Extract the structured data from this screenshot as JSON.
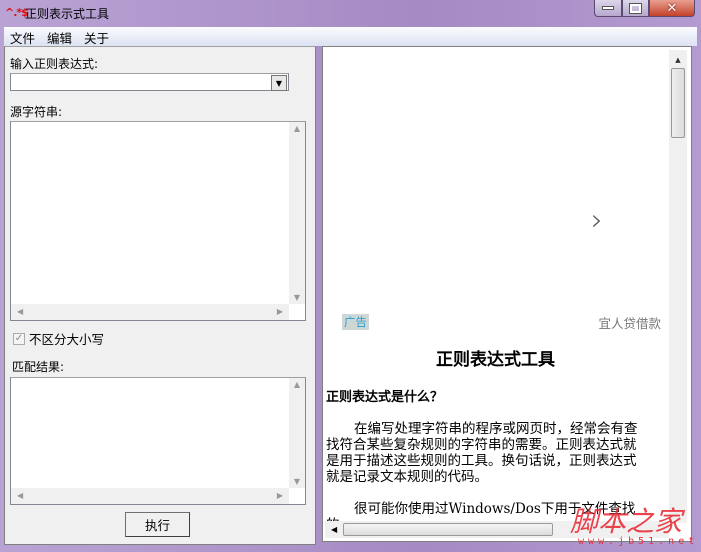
{
  "window": {
    "title": "正则表示式工具",
    "icon_text": "^.*$",
    "minimize": "▭",
    "maximize": "▢",
    "close": "✕"
  },
  "menu": [
    "文件",
    "编辑",
    "关于"
  ],
  "left": {
    "regex_label": "输入正则表达式:",
    "regex_value": "",
    "source_label": "源字符串:",
    "source_value": "",
    "case_checkbox": {
      "label": "不区分大小写",
      "checked": true
    },
    "result_label": "匹配结果:",
    "result_value": "",
    "execute_button": "执行"
  },
  "browser": {
    "ad_badge": "广告",
    "ad_text": "宜人贷借款",
    "next_arrow": "›",
    "heading": "正则表达式工具",
    "subheading": "正则表达式是什么？",
    "paragraphs": [
      "在编写处理字符串的程序或网页时，经常会有查找符合某些复杂规则的字符串的需要。正则表达式就是用于描述这些规则的工具。换句话说，正则表达式就是记录文本规则的代码。",
      "很可能你使用过Windows/Dos下用于文件查找的"
    ]
  },
  "watermark": {
    "text": "脚本之家",
    "url": "www.jb51.net"
  }
}
